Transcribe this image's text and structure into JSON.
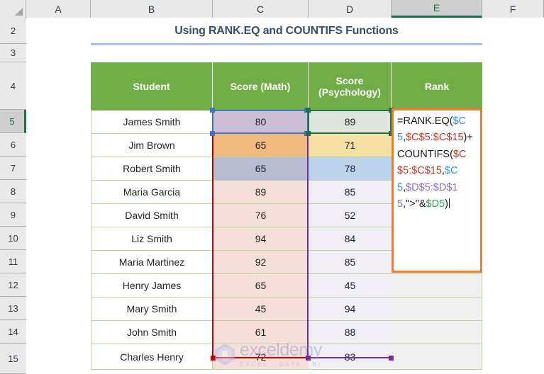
{
  "app": {
    "type": "spreadsheet",
    "active_cell": "E5",
    "active_column": "E",
    "active_row": "5"
  },
  "grid": {
    "column_headers": [
      "A",
      "B",
      "C",
      "D",
      "E",
      "F"
    ],
    "row_headers": [
      "2",
      "3",
      "4",
      "5",
      "6",
      "7",
      "8",
      "9",
      "10",
      "11",
      "12",
      "13",
      "14",
      "15"
    ]
  },
  "title": {
    "text": "Using RANK.EQ and COUNTIFS Functions",
    "color": "#36506b",
    "rule_color": "#a8c0e8"
  },
  "table": {
    "header_fill": "#70ad47",
    "header_text_color": "#ffffff",
    "columns": [
      {
        "label": "Student"
      },
      {
        "label": "Score (Math)"
      },
      {
        "label": "Score (Psychology)"
      },
      {
        "label": "Rank"
      }
    ],
    "rows": [
      {
        "row": "5",
        "student": "James Smith",
        "math": "80",
        "psych": "89",
        "math_fill": "#cdc0d6",
        "psych_fill": "#dde5de"
      },
      {
        "row": "6",
        "student": "Jim Brown",
        "math": "65",
        "psych": "71",
        "math_fill": "#eeb97a",
        "psych_fill": "#f4dea2"
      },
      {
        "row": "7",
        "student": "Robert Smith",
        "math": "65",
        "psych": "78",
        "math_fill": "#b8bcd2",
        "psych_fill": "#bcd3ec"
      },
      {
        "row": "8",
        "student": "Maria Garcia",
        "math": "89",
        "psych": "85",
        "math_fill": "#f6dedb",
        "psych_fill": "#f1eef6"
      },
      {
        "row": "9",
        "student": "David Smith",
        "math": "76",
        "psych": "52",
        "math_fill": "#f6dedb",
        "psych_fill": "#f1eef6"
      },
      {
        "row": "10",
        "student": "Liz Smith",
        "math": "94",
        "psych": "84",
        "math_fill": "#f6dedb",
        "psych_fill": "#f1eef6"
      },
      {
        "row": "11",
        "student": "Maria Martinez",
        "math": "92",
        "psych": "85",
        "math_fill": "#f6dedb",
        "psych_fill": "#f1eef6"
      },
      {
        "row": "12",
        "student": "Henry James",
        "math": "65",
        "psych": "45",
        "math_fill": "#f6dedb",
        "psych_fill": "#f1eef6"
      },
      {
        "row": "13",
        "student": "Mary Smith",
        "math": "45",
        "psych": "94",
        "math_fill": "#f6dedb",
        "psych_fill": "#f1eef6"
      },
      {
        "row": "14",
        "student": "John Smith",
        "math": "61",
        "psych": "88",
        "math_fill": "#f6dedb",
        "psych_fill": "#f1eef6"
      },
      {
        "row": "15",
        "student": "Charles Henry",
        "math": "72",
        "psych": "83",
        "math_fill": "#f6dedb",
        "psych_fill": "#f1eef6"
      }
    ]
  },
  "formula_cell": {
    "cell": "E5",
    "border_color": "#ed7d31",
    "full_text": "=RANK.EQ($C5,$C$5:$C$15)+COUNTIFS($C$5:$C$15,$C5,$D$5:$D$15,\">\"&$D5)",
    "tokens": [
      {
        "t": "=RANK.EQ(",
        "c": "plain"
      },
      {
        "t": "$C5",
        "c": "blue"
      },
      {
        "t": ",",
        "c": "plain"
      },
      {
        "t": "$C$5:$C$15",
        "c": "red"
      },
      {
        "t": ")+",
        "c": "plain"
      },
      {
        "t": "COUNTIFS(",
        "c": "plain"
      },
      {
        "t": "$C$5:$C$15",
        "c": "red"
      },
      {
        "t": ",",
        "c": "plain"
      },
      {
        "t": "$C5",
        "c": "blue"
      },
      {
        "t": ",",
        "c": "plain"
      },
      {
        "t": "$D$5:$D$15",
        "c": "purple"
      },
      {
        "t": ",\">\"&",
        "c": "plain"
      },
      {
        "t": "$D5",
        "c": "green"
      },
      {
        "t": ")",
        "c": "plain"
      }
    ]
  },
  "references": {
    "c5": {
      "color": "#4472c4",
      "label": "$C5 blue reference box"
    },
    "d5": {
      "color": "#1e7145",
      "label": "$D5 green reference box"
    },
    "c_range": {
      "color": "#c00000",
      "label": "$C$5:$C$15 red range border"
    },
    "d_range": {
      "color": "#7030a0",
      "label": "$D$5:$D$15 purple range border"
    }
  },
  "watermark": {
    "main": "exceldemy",
    "sub": "EXCEL · DATA · BI"
  }
}
